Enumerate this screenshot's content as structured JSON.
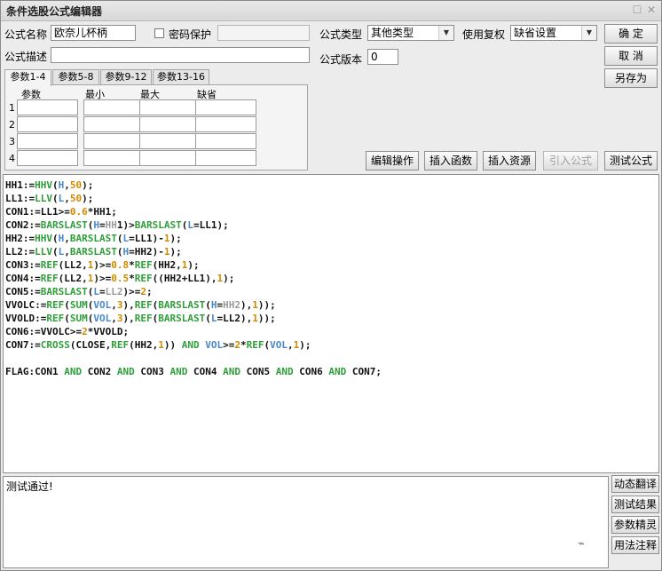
{
  "window": {
    "title": "条件选股公式编辑器",
    "restore_glyph": "☐",
    "close_glyph": "✕"
  },
  "form": {
    "name_label": "公式名称",
    "name_value": "欧奈儿杯柄",
    "password_label": "密码保护",
    "password_value": "",
    "type_label": "公式类型",
    "type_value": "其他类型",
    "restore_label": "使用复权",
    "restore_value": "缺省设置",
    "desc_label": "公式描述",
    "desc_value": "",
    "version_label": "公式版本",
    "version_value": "0"
  },
  "buttons": {
    "ok": "确  定",
    "cancel": "取  消",
    "save_as": "另存为"
  },
  "tabs": [
    "参数1-4",
    "参数5-8",
    "参数9-12",
    "参数13-16"
  ],
  "params": {
    "headers": [
      "参数",
      "最小",
      "最大",
      "缺省"
    ],
    "rows": [
      "1",
      "2",
      "3",
      "4"
    ]
  },
  "toolbar": {
    "edit_ops": "编辑操作",
    "insert_func": "插入函数",
    "insert_res": "插入资源",
    "import_formula": "引入公式",
    "test_formula": "测试公式"
  },
  "code_lines": [
    [
      [
        "t",
        "HH1"
      ],
      [
        "p",
        ":="
      ],
      [
        "f",
        "HHV"
      ],
      [
        "p",
        "("
      ],
      [
        "b",
        "H"
      ],
      [
        "p",
        ","
      ],
      [
        "n",
        "50"
      ],
      [
        "p",
        ");"
      ]
    ],
    [
      [
        "t",
        "LL1"
      ],
      [
        "p",
        ":="
      ],
      [
        "f",
        "LLV"
      ],
      [
        "p",
        "("
      ],
      [
        "b",
        "L"
      ],
      [
        "p",
        ","
      ],
      [
        "n",
        "50"
      ],
      [
        "p",
        ");"
      ]
    ],
    [
      [
        "t",
        "CON1"
      ],
      [
        "p",
        ":=LL1>="
      ],
      [
        "n",
        "0.6"
      ],
      [
        "p",
        "*HH1;"
      ]
    ],
    [
      [
        "t",
        "CON2"
      ],
      [
        "p",
        ":="
      ],
      [
        "f",
        "BARSLAST"
      ],
      [
        "p",
        "("
      ],
      [
        "b",
        "H"
      ],
      [
        "p",
        "="
      ],
      [
        "g",
        "HH"
      ],
      [
        "p",
        "1)>"
      ],
      [
        "f",
        "BARSLAST"
      ],
      [
        "p",
        "("
      ],
      [
        "b",
        "L"
      ],
      [
        "p",
        "=LL1);"
      ]
    ],
    [
      [
        "t",
        "HH2"
      ],
      [
        "p",
        ":="
      ],
      [
        "f",
        "HHV"
      ],
      [
        "p",
        "("
      ],
      [
        "b",
        "H"
      ],
      [
        "p",
        ","
      ],
      [
        "f",
        "BARSLAST"
      ],
      [
        "p",
        "("
      ],
      [
        "b",
        "L"
      ],
      [
        "p",
        "=LL1)-"
      ],
      [
        "n",
        "1"
      ],
      [
        "p",
        ");"
      ]
    ],
    [
      [
        "t",
        "LL2"
      ],
      [
        "p",
        ":="
      ],
      [
        "f",
        "LLV"
      ],
      [
        "p",
        "("
      ],
      [
        "b",
        "L"
      ],
      [
        "p",
        ","
      ],
      [
        "f",
        "BARSLAST"
      ],
      [
        "p",
        "("
      ],
      [
        "b",
        "H"
      ],
      [
        "p",
        "=HH2)-"
      ],
      [
        "n",
        "1"
      ],
      [
        "p",
        ");"
      ]
    ],
    [
      [
        "t",
        "CON3"
      ],
      [
        "p",
        ":="
      ],
      [
        "f",
        "REF"
      ],
      [
        "p",
        "(LL2,"
      ],
      [
        "n",
        "1"
      ],
      [
        "p",
        ")>="
      ],
      [
        "n",
        "0.8"
      ],
      [
        "p",
        "*"
      ],
      [
        "f",
        "REF"
      ],
      [
        "p",
        "(HH2,"
      ],
      [
        "n",
        "1"
      ],
      [
        "p",
        ");"
      ]
    ],
    [
      [
        "t",
        "CON4"
      ],
      [
        "p",
        ":="
      ],
      [
        "f",
        "REF"
      ],
      [
        "p",
        "(LL2,"
      ],
      [
        "n",
        "1"
      ],
      [
        "p",
        ")>="
      ],
      [
        "n",
        "0.5"
      ],
      [
        "p",
        "*"
      ],
      [
        "f",
        "REF"
      ],
      [
        "p",
        "((HH2+LL1),"
      ],
      [
        "n",
        "1"
      ],
      [
        "p",
        ");"
      ]
    ],
    [
      [
        "t",
        "CON5"
      ],
      [
        "p",
        ":="
      ],
      [
        "f",
        "BARSLAST"
      ],
      [
        "p",
        "("
      ],
      [
        "b",
        "L"
      ],
      [
        "p",
        "="
      ],
      [
        "g",
        "LL2"
      ],
      [
        "p",
        ")>="
      ],
      [
        "n",
        "2"
      ],
      [
        "p",
        ";"
      ]
    ],
    [
      [
        "t",
        "VVOLC"
      ],
      [
        "p",
        ":="
      ],
      [
        "f",
        "REF"
      ],
      [
        "p",
        "("
      ],
      [
        "f",
        "SUM"
      ],
      [
        "p",
        "("
      ],
      [
        "b",
        "VOL"
      ],
      [
        "p",
        ","
      ],
      [
        "n",
        "3"
      ],
      [
        "p",
        "),"
      ],
      [
        "f",
        "REF"
      ],
      [
        "p",
        "("
      ],
      [
        "f",
        "BARSLAST"
      ],
      [
        "p",
        "("
      ],
      [
        "b",
        "H"
      ],
      [
        "p",
        "="
      ],
      [
        "g",
        "HH2"
      ],
      [
        "p",
        "),"
      ],
      [
        "n",
        "1"
      ],
      [
        "p",
        "));"
      ]
    ],
    [
      [
        "t",
        "VVOLD"
      ],
      [
        "p",
        ":="
      ],
      [
        "f",
        "REF"
      ],
      [
        "p",
        "("
      ],
      [
        "f",
        "SUM"
      ],
      [
        "p",
        "("
      ],
      [
        "b",
        "VOL"
      ],
      [
        "p",
        ","
      ],
      [
        "n",
        "3"
      ],
      [
        "p",
        "),"
      ],
      [
        "f",
        "REF"
      ],
      [
        "p",
        "("
      ],
      [
        "f",
        "BARSLAST"
      ],
      [
        "p",
        "("
      ],
      [
        "b",
        "L"
      ],
      [
        "p",
        "=LL2),"
      ],
      [
        "n",
        "1"
      ],
      [
        "p",
        "));"
      ]
    ],
    [
      [
        "t",
        "CON6"
      ],
      [
        "p",
        ":=VVOLC>="
      ],
      [
        "n",
        "2"
      ],
      [
        "p",
        "*VVOLD;"
      ]
    ],
    [
      [
        "t",
        "CON7"
      ],
      [
        "p",
        ":="
      ],
      [
        "f",
        "CROSS"
      ],
      [
        "p",
        "("
      ],
      [
        "t",
        "CLOSE"
      ],
      [
        "p",
        ","
      ],
      [
        "f",
        "REF"
      ],
      [
        "p",
        "(HH2,"
      ],
      [
        "n",
        "1"
      ],
      [
        "p",
        ")) "
      ],
      [
        "k",
        "AND"
      ],
      [
        "p",
        " "
      ],
      [
        "b",
        "VOL"
      ],
      [
        "p",
        ">="
      ],
      [
        "n",
        "2"
      ],
      [
        "p",
        "*"
      ],
      [
        "f",
        "REF"
      ],
      [
        "p",
        "("
      ],
      [
        "b",
        "VOL"
      ],
      [
        "p",
        ","
      ],
      [
        "n",
        "1"
      ],
      [
        "p",
        ");"
      ]
    ],
    [],
    [
      [
        "t",
        "FLAG"
      ],
      [
        "p",
        ":CON1 "
      ],
      [
        "k",
        "AND"
      ],
      [
        "p",
        " CON2 "
      ],
      [
        "k",
        "AND"
      ],
      [
        "p",
        " CON3 "
      ],
      [
        "k",
        "AND"
      ],
      [
        "p",
        " CON4 "
      ],
      [
        "k",
        "AND"
      ],
      [
        "p",
        " CON5 "
      ],
      [
        "k",
        "AND"
      ],
      [
        "p",
        " CON6 "
      ],
      [
        "k",
        "AND"
      ],
      [
        "p",
        " CON7;"
      ]
    ]
  ],
  "output": {
    "text": "测试通过!"
  },
  "side_buttons": [
    "动态翻译",
    "测试结果",
    "参数精灵",
    "用法注释"
  ],
  "watermark_glyph": "⌁"
}
